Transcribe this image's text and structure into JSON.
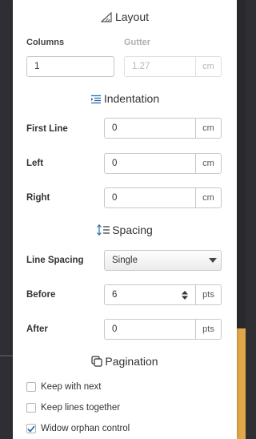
{
  "layout": {
    "header": "Layout",
    "columns_label": "Columns",
    "gutter_label": "Gutter",
    "columns_value": "1",
    "gutter_value": "1.27",
    "gutter_unit": "cm"
  },
  "indentation": {
    "header": "Indentation",
    "first_line_label": "First Line",
    "first_line_value": "0",
    "left_label": "Left",
    "left_value": "0",
    "right_label": "Right",
    "right_value": "0",
    "unit": "cm"
  },
  "spacing": {
    "header": "Spacing",
    "line_spacing_label": "Line Spacing",
    "line_spacing_value": "Single",
    "before_label": "Before",
    "before_value": "6",
    "after_label": "After",
    "after_value": "0",
    "unit": "pts"
  },
  "pagination": {
    "header": "Pagination",
    "options": [
      {
        "label": "Keep with next",
        "checked": false
      },
      {
        "label": "Keep lines together",
        "checked": false
      },
      {
        "label": "Widow orphan control",
        "checked": true
      }
    ]
  },
  "colors": {
    "accent": "#2b6cb0",
    "panel_bg": "#ffffff",
    "app_bg": "#2f2f33",
    "highlight": "#e4b25a"
  }
}
